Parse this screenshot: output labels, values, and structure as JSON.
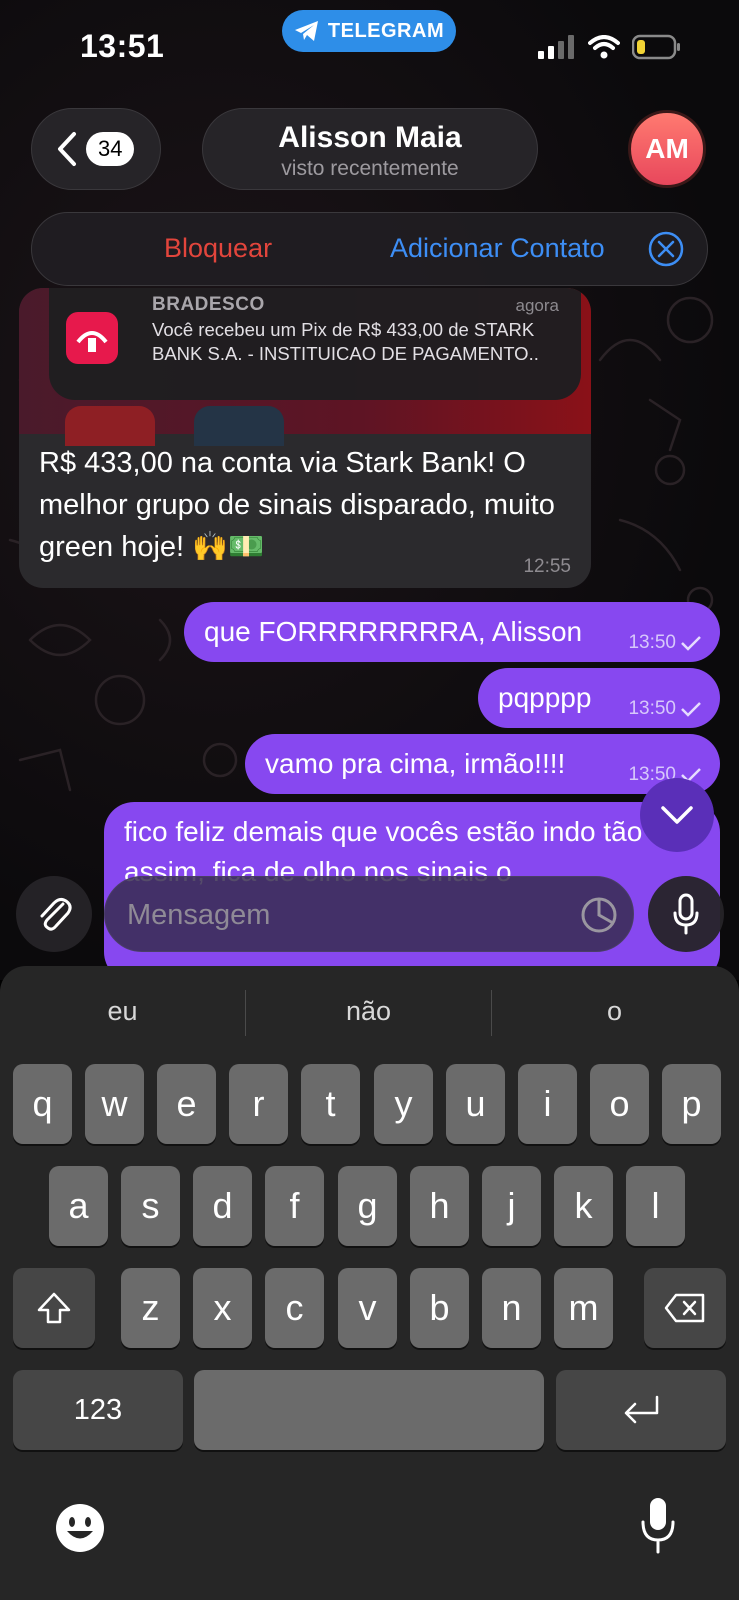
{
  "status_bar": {
    "time": "13:51",
    "app_pill": "TELEGRAM"
  },
  "header": {
    "unread_count": "34",
    "contact_name": "Alisson Maia",
    "contact_status": "visto recentemente",
    "avatar_initials": "AM",
    "block_label": "Bloquear",
    "add_contact_label": "Adicionar Contato"
  },
  "incoming": {
    "notification": {
      "app": "BRADESCO",
      "when": "agora",
      "body": "Você recebeu um Pix de R$ 433,00 de STARK BANK S.A. - INSTITUICAO DE PAGAMENTO.."
    },
    "text": "R$ 433,00 na conta via Stark Bank! O melhor grupo de sinais disparado, muito green hoje! 🙌💵",
    "time": "12:55"
  },
  "outgoing": [
    {
      "text": "que FORRRRRRRRA, Alisson",
      "time": "13:50"
    },
    {
      "text": "pqpppp",
      "time": "13:50"
    },
    {
      "text": "vamo pra cima, irmão!!!!",
      "time": "13:50"
    },
    {
      "text": "fico feliz demais que vocês estão indo tão bem assim, fica de olho nos sinais o"
    }
  ],
  "composer": {
    "placeholder": "Mensagem"
  },
  "keyboard": {
    "suggestions": [
      "eu",
      "não",
      "o"
    ],
    "row1": [
      "q",
      "w",
      "e",
      "r",
      "t",
      "y",
      "u",
      "i",
      "o",
      "p"
    ],
    "row2": [
      "a",
      "s",
      "d",
      "f",
      "g",
      "h",
      "j",
      "k",
      "l"
    ],
    "row3": [
      "z",
      "x",
      "c",
      "v",
      "b",
      "n",
      "m"
    ],
    "numbers_key": "123"
  },
  "colors": {
    "accent_purple": "#8748f0",
    "telegram_blue": "#2e8ee8",
    "block_red": "#e2453c",
    "link_blue": "#3d8ef5",
    "bradesco_red": "#e7194c"
  },
  "icons": [
    "telegram-icon",
    "signal-icon",
    "wifi-icon",
    "battery-icon",
    "chevron-left-icon",
    "close-circle-icon",
    "paperclip-icon",
    "sticker-icon",
    "microphone-icon",
    "chevron-down-icon",
    "shift-icon",
    "backspace-icon",
    "return-icon",
    "emoji-icon",
    "dictation-icon"
  ]
}
